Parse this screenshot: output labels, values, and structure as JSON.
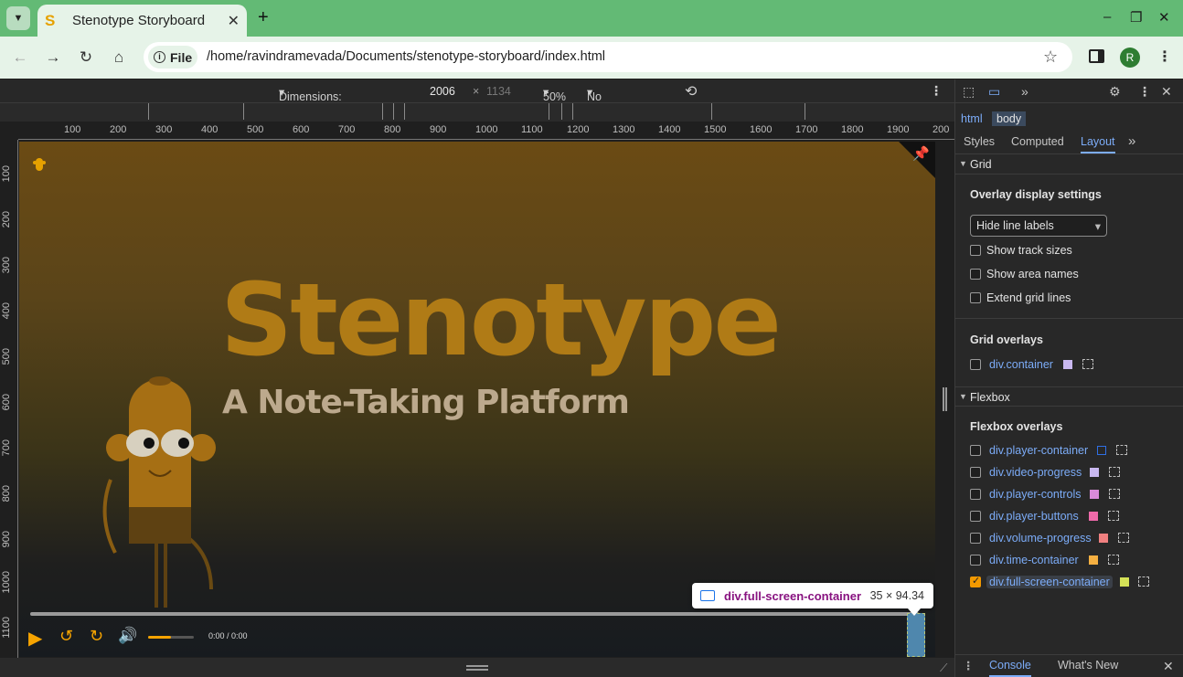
{
  "browser": {
    "tab_title": "Stenotype Storyboard",
    "tab_favicon": "S",
    "new_tab": "+",
    "address_chip": "File",
    "url": "/home/ravindramevada/Documents/stenotype-storyboard/index.html",
    "avatar_letter": "R",
    "window_controls": [
      "–",
      "❐",
      "✕"
    ]
  },
  "device_toolbar": {
    "dimensions": "Dimensions: Responsive",
    "width": "2006",
    "times": "×",
    "height": "1134",
    "zoom": "50%",
    "throttling": "No throttling"
  },
  "rulers": {
    "horizontal": [
      "100",
      "200",
      "300",
      "400",
      "500",
      "600",
      "700",
      "800",
      "900",
      "1000",
      "1100",
      "1200",
      "1300",
      "1400",
      "1500",
      "1600",
      "1700",
      "1800",
      "1900",
      "200"
    ],
    "vertical": [
      "100",
      "200",
      "300",
      "400",
      "500",
      "600",
      "700",
      "800",
      "900",
      "1000",
      "1100"
    ]
  },
  "page": {
    "title": "Stenotype",
    "subtitle": "A Note-Taking Platform",
    "time": "0:00 / 0:00",
    "volume_level": 0.5,
    "accent": "#f5a300"
  },
  "tooltip": {
    "element": "div.full-screen-container",
    "size": "35 × 94.34"
  },
  "devtools": {
    "crumbs": [
      "html",
      "body"
    ],
    "tabs": [
      "Styles",
      "Computed",
      "Layout"
    ],
    "grid_section": "Grid",
    "overlay_settings": "Overlay display settings",
    "line_labels": "Hide line labels",
    "grid_options": [
      "Show track sizes",
      "Show area names",
      "Extend grid lines"
    ],
    "grid_overlays_title": "Grid overlays",
    "grid_overlays": [
      {
        "name": "div.container",
        "color": "#c9b8f0"
      }
    ],
    "flexbox_section": "Flexbox",
    "flexbox_overlays_title": "Flexbox overlays",
    "flexbox_overlays": [
      {
        "name": "div.player-container",
        "color": "#2a2a7a",
        "checked": false
      },
      {
        "name": "div.video-progress",
        "color": "#c9b8f0",
        "checked": false
      },
      {
        "name": "div.player-controls",
        "color": "#d98ad9",
        "checked": false
      },
      {
        "name": "div.player-buttons",
        "color": "#f06aaa",
        "checked": false
      },
      {
        "name": "div.volume-progress",
        "color": "#f08080",
        "checked": false
      },
      {
        "name": "div.time-container",
        "color": "#f5b041",
        "checked": false
      },
      {
        "name": "div.full-screen-container",
        "color": "#d4e157",
        "checked": true
      }
    ],
    "drawer_tabs": [
      "Console",
      "What's New"
    ]
  }
}
